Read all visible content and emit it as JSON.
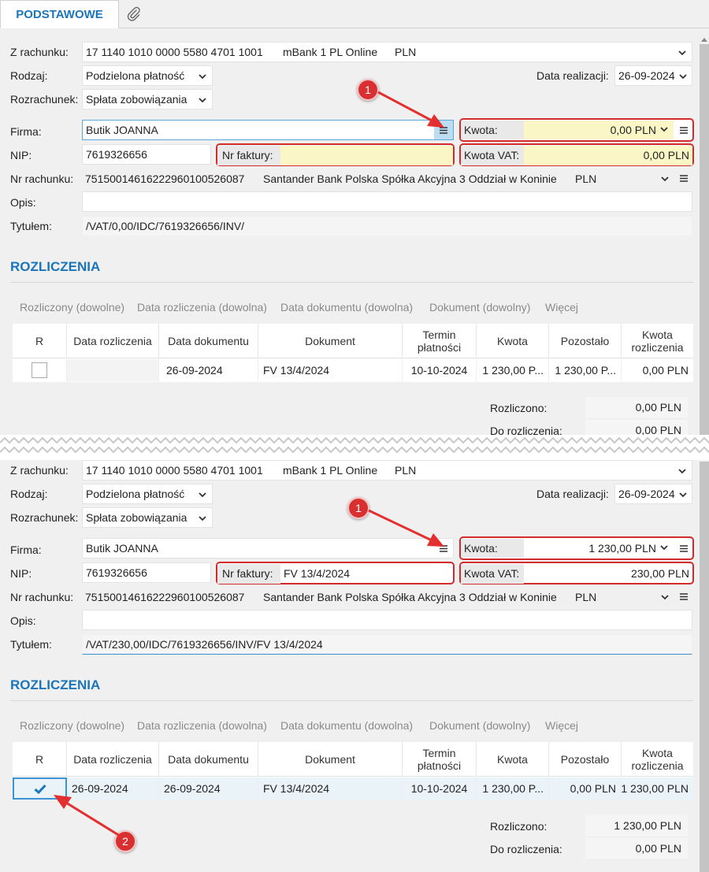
{
  "tabs": {
    "main": "PODSTAWOWE",
    "attach_icon": "paperclip-icon"
  },
  "labels": {
    "z_rachunku": "Z rachunku:",
    "rodzaj": "Rodzaj:",
    "rozrachunek": "Rozrachunek:",
    "data_realizacji": "Data realizacji:",
    "firma": "Firma:",
    "nip": "NIP:",
    "nr_faktury": "Nr faktury:",
    "kwota": "Kwota:",
    "kwota_vat": "Kwota VAT:",
    "nr_rachunku": "Nr rachunku:",
    "opis": "Opis:",
    "tytulem": "Tytułem:"
  },
  "section_title": "ROZLICZENIA",
  "filters": [
    "Rozliczony (dowolne)",
    "Data rozliczenia (dowolna)",
    "Data dokumentu (dowolna)",
    "Dokument (dowolny)",
    "Więcej"
  ],
  "columns": [
    "R",
    "Data rozliczenia",
    "Data dokumentu",
    "Dokument",
    "Termin płatności",
    "Kwota",
    "Pozostało",
    "Kwota rozliczenia"
  ],
  "summary_labels": {
    "rozliczono": "Rozliczono:",
    "do_rozliczenia": "Do rozliczenia:"
  },
  "top": {
    "z_rachunku": {
      "number": "17 1140 1010 0000 5580 4701 1001",
      "bank": "mBank 1 PL Online",
      "currency": "PLN"
    },
    "rodzaj": "Podzielona płatność",
    "rozrachunek": "Spłata zobowiązania",
    "data_realizacji": "26-09-2024",
    "firma": "Butik JOANNA",
    "nip": "7619326656",
    "nr_faktury": "",
    "kwota": "0,00 PLN",
    "kwota_vat": "0,00 PLN",
    "nr_rachunku": {
      "number": "75150014616222960100526087",
      "bank": "Santander Bank Polska Spółka Akcyjna 3 Oddział w Koninie",
      "currency": "PLN"
    },
    "opis": "",
    "tytulem": "/VAT/0,00/IDC/7619326656/INV/",
    "row": {
      "checked": false,
      "data_rozliczenia": "",
      "data_dokumentu": "26-09-2024",
      "dokument": "FV 13/4/2024",
      "termin": "10-10-2024",
      "kwota": "1 230,00 P...",
      "pozostalo": "1 230,00 P...",
      "kwota_rozliczenia": "0,00 PLN"
    },
    "rozliczono": "0,00 PLN",
    "do_rozliczenia": "0,00 PLN"
  },
  "bottom": {
    "z_rachunku": {
      "number": "17 1140 1010 0000 5580 4701 1001",
      "bank": "mBank 1 PL Online",
      "currency": "PLN"
    },
    "rodzaj": "Podzielona płatność",
    "rozrachunek": "Spłata zobowiązania",
    "data_realizacji": "26-09-2024",
    "firma": "Butik JOANNA",
    "nip": "7619326656",
    "nr_faktury": "FV 13/4/2024",
    "kwota": "1 230,00 PLN",
    "kwota_vat": "230,00 PLN",
    "nr_rachunku": {
      "number": "75150014616222960100526087",
      "bank": "Santander Bank Polska Spółka Akcyjna 3 Oddział w Koninie",
      "currency": "PLN"
    },
    "opis": "",
    "tytulem": "/VAT/230,00/IDC/7619326656/INV/FV 13/4/2024",
    "row": {
      "checked": true,
      "data_rozliczenia": "26-09-2024",
      "data_dokumentu": "26-09-2024",
      "dokument": "FV 13/4/2024",
      "termin": "10-10-2024",
      "kwota": "1 230,00 P...",
      "pozostalo": "0,00 PLN",
      "kwota_rozliczenia": "1 230,00 PLN"
    },
    "rozliczono": "1 230,00 PLN",
    "do_rozliczenia": "0,00 PLN"
  },
  "annotations": {
    "badge1": "1",
    "badge2": "2"
  },
  "colors": {
    "accent": "#1b75bb",
    "highlight_red": "#d42a2a",
    "required_yellow": "#fbf6c6"
  }
}
